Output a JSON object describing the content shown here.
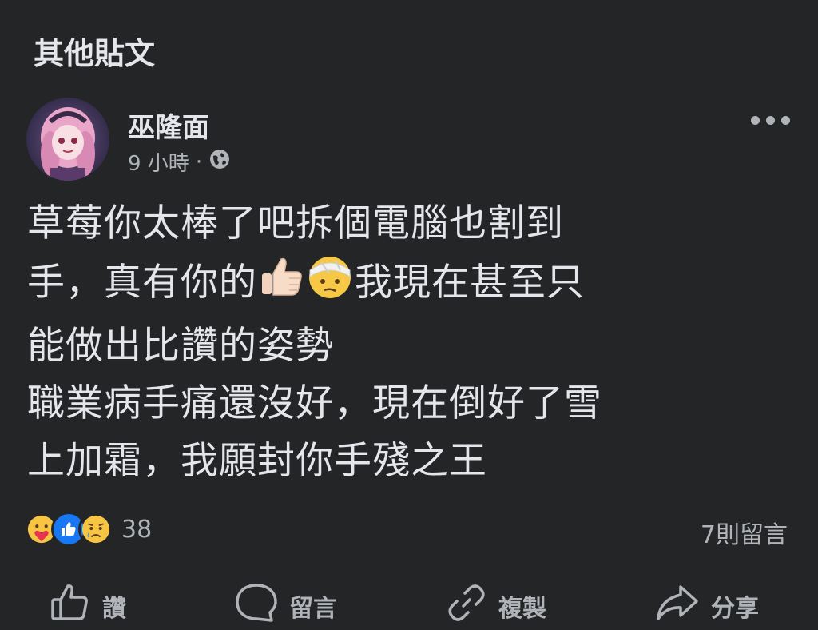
{
  "header": {
    "title": "其他貼文"
  },
  "post": {
    "author": "巫隆面",
    "time": "9 小時",
    "separator": "·",
    "privacy_icon": "globe-icon",
    "more_icon": "more-dots-icon",
    "text_lines": [
      {
        "a": "草莓你太棒了吧拆個電腦也割到",
        "b": ""
      },
      {
        "a": "手，真有你的",
        "b": "我現在甚至只"
      },
      {
        "a": "能做出比讚的姿勢",
        "b": ""
      },
      {
        "a": "職業病手痛還沒好，現在倒好了雪",
        "b": ""
      },
      {
        "a": "上加霜，我願封你手殘之王",
        "b": ""
      }
    ],
    "inline_emojis": [
      "thumbs-up-emoji",
      "bandaged-face-emoji"
    ]
  },
  "reactions": {
    "icons": [
      "care-icon",
      "like-icon",
      "sad-icon"
    ],
    "count": "38",
    "comments": "7則留言"
  },
  "actions": {
    "like": "讚",
    "comment": "留言",
    "copy": "複製",
    "share": "分享"
  },
  "colors": {
    "background": "#242526",
    "text": "#e4e6eb",
    "secondary": "#b0b3b8",
    "like_blue": "#1877f2"
  }
}
